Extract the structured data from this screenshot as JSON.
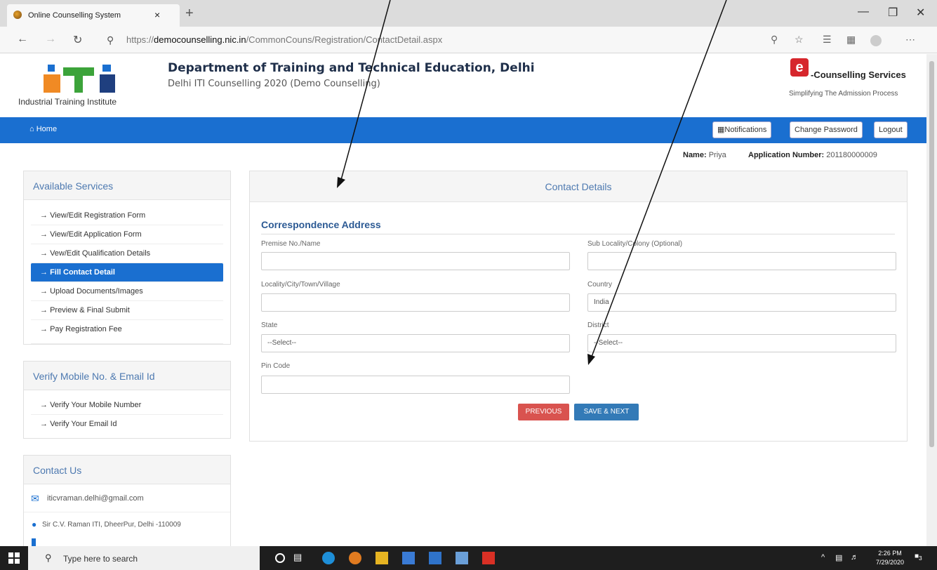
{
  "browser": {
    "tab_title": "Online Counselling System",
    "tab_close": "×",
    "new_tab": "+",
    "url_prefix": "https://",
    "url_domain": "democounselling.nic.in",
    "url_path": "/CommonCouns/Registration/ContactDetail.aspx"
  },
  "header": {
    "logo_caption": "Industrial Training Institute",
    "department": "Department of Training and Technical Education, Delhi",
    "subtitle": "Delhi ITI Counselling 2020 (Demo Counselling)",
    "ec_mark": "e",
    "ec_name": "-Counselling Services",
    "ec_tagline": "Simplifying The Admission Process"
  },
  "nav": {
    "home": "Home",
    "notifications": "Notifications",
    "change_password": "Change Password",
    "logout": "Logout"
  },
  "user": {
    "name_label": "Name:",
    "name": "Priya",
    "app_label": "Application Number:",
    "app_number": "201180000009"
  },
  "services": {
    "title": "Available Services",
    "items": [
      {
        "label": "View/Edit Registration Form"
      },
      {
        "label": "View/Edit Application Form"
      },
      {
        "label": "Vew/Edit Qualification Details"
      },
      {
        "label": "Fill Contact Detail"
      },
      {
        "label": "Upload Documents/Images"
      },
      {
        "label": "Preview & Final Submit"
      },
      {
        "label": "Pay Registration Fee"
      }
    ]
  },
  "verify": {
    "title": "Verify Mobile No. & Email Id",
    "items": [
      {
        "label": "Verify Your Mobile Number"
      },
      {
        "label": "Verify Your Email Id"
      }
    ]
  },
  "contact": {
    "title": "Contact Us",
    "email": "iticvraman.delhi@gmail.com",
    "address": "Sir C.V. Raman ITI, DheerPur, Delhi -110009"
  },
  "form": {
    "title": "Contact Details",
    "section": "Correspondence Address",
    "premise_label": "Premise No./Name",
    "premise_value": "",
    "sublocality_label": "Sub Locality/Colony (Optional)",
    "sublocality_value": "",
    "locality_label": "Locality/City/Town/Village",
    "locality_value": "",
    "country_label": "Country",
    "country_value": "India",
    "state_label": "State",
    "state_value": "--Select--",
    "district_label": "District",
    "district_value": "--Select--",
    "pin_label": "Pin Code",
    "pin_value": "",
    "previous": "PREVIOUS",
    "save_next": "SAVE & NEXT"
  },
  "taskbar": {
    "search_placeholder": "Type here to search",
    "time": "2:26 PM",
    "date": "7/29/2020",
    "notifications_count": "3"
  },
  "colors": {
    "primary": "#1a6fd0",
    "previous": "#d9534f",
    "save": "#337ab7",
    "panel_title": "#4d79b0"
  }
}
